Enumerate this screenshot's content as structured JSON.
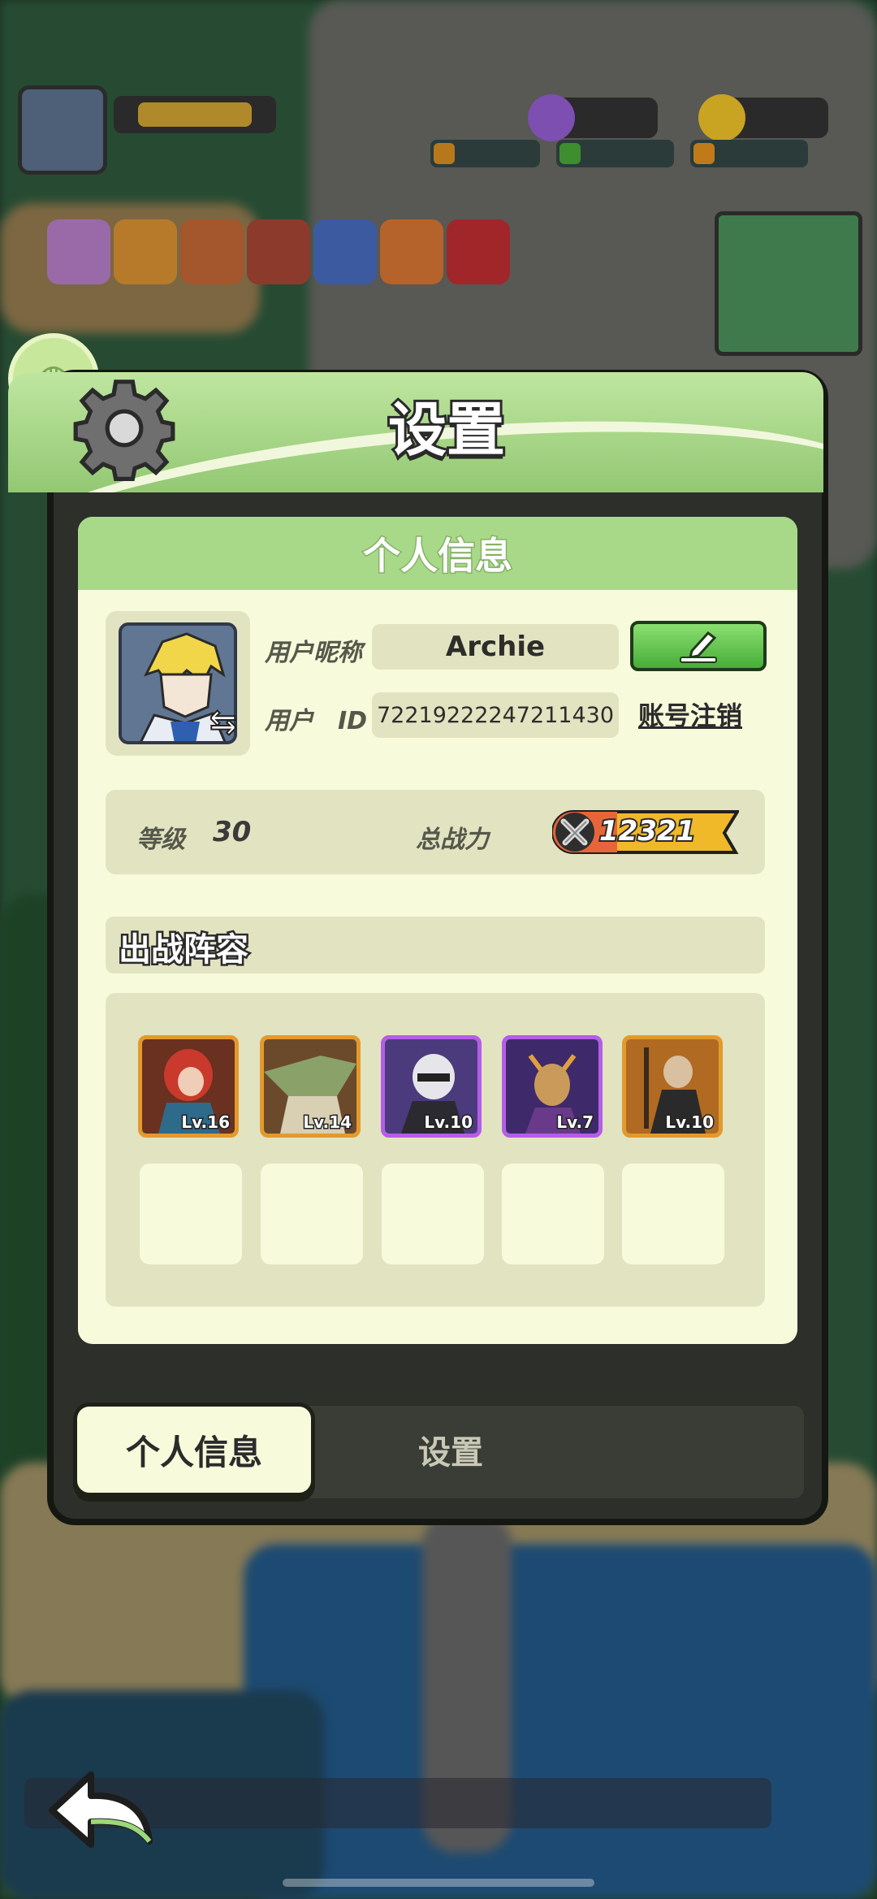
{
  "panel": {
    "title": "设置"
  },
  "profile_card": {
    "header": "个人信息",
    "nickname_label": "用户昵称",
    "nickname_value": "Archie",
    "id_label": "用户　ID",
    "id_value": "72219222247211430",
    "cancel_account_label": "账号注销",
    "level_label": "等级",
    "level_value": "30",
    "power_label": "总战力",
    "power_value": "12321"
  },
  "lineup": {
    "title": "出战阵容",
    "heroes": [
      {
        "level": "Lv.16",
        "frame": "gold"
      },
      {
        "level": "Lv.14",
        "frame": "gold"
      },
      {
        "level": "Lv.10",
        "frame": "purple"
      },
      {
        "level": "Lv.7",
        "frame": "purple"
      },
      {
        "level": "Lv.10",
        "frame": "gold"
      }
    ],
    "empty_slots": 5
  },
  "tabs": {
    "profile": "个人信息",
    "settings": "设置"
  },
  "colors": {
    "header_green": "#a8d988",
    "card_bg": "#f7fbdb",
    "field_bg": "#e2e3c1",
    "edit_button": "#48ad38",
    "hero_gold": "#e39a2c",
    "hero_purple": "#b45ee8"
  }
}
